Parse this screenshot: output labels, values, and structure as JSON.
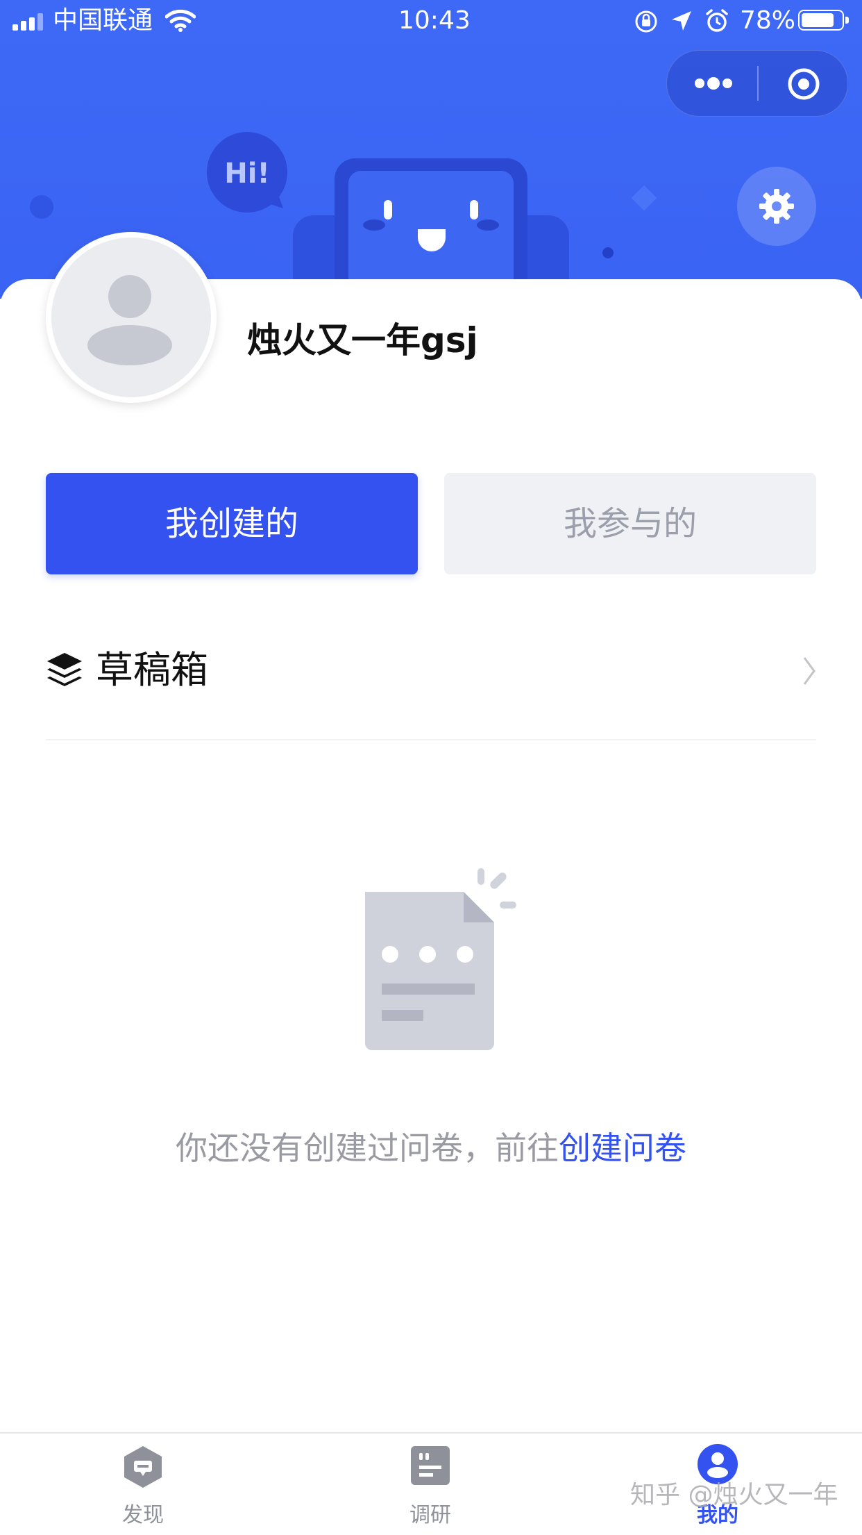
{
  "status_bar": {
    "carrier": "中国联通",
    "time": "10:43",
    "battery": "78%"
  },
  "banner": {
    "hi_text": "Hi!"
  },
  "profile": {
    "username": "烛火又一年gsj"
  },
  "tabs": {
    "created_label": "我创建的",
    "joined_label": "我参与的"
  },
  "drafts": {
    "label": "草稿箱"
  },
  "empty_state": {
    "message": "你还没有创建过问卷，前往",
    "link": "创建问卷"
  },
  "tabbar": {
    "items": [
      {
        "label": "发现",
        "icon": "discover-icon",
        "active": false
      },
      {
        "label": "调研",
        "icon": "survey-icon",
        "active": false
      },
      {
        "label": "我的",
        "icon": "profile-icon",
        "active": true
      }
    ]
  },
  "watermark": "知乎 @烛火又一年",
  "colors": {
    "header_blue": "#3e69f6",
    "accent": "#3452f0",
    "inactive_button": "#f0f1f5"
  }
}
